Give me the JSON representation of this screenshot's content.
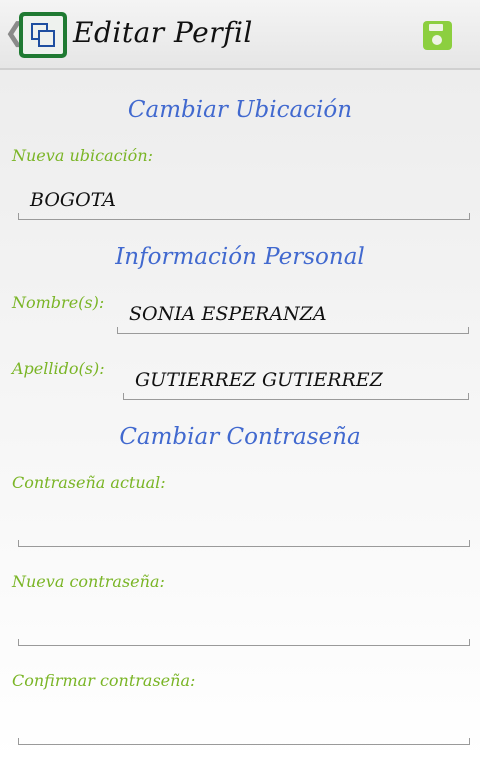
{
  "appbar": {
    "title": "Editar Perfil",
    "back_glyph": "❮",
    "icons": {
      "app": "app-logo-icon",
      "save": "save-icon"
    },
    "accent": "#8ccf3f"
  },
  "sections": {
    "location_title": "Cambiar Ubicación",
    "personal_title": "Información Personal",
    "password_title": "Cambiar Contraseña"
  },
  "fields": {
    "location": {
      "label": "Nueva ubicación:",
      "value": "BOGOTA"
    },
    "first_name": {
      "label": "Nombre(s):",
      "value": "SONIA ESPERANZA"
    },
    "last_name": {
      "label": "Apellido(s):",
      "value": "GUTIERREZ GUTIERREZ"
    },
    "current_password": {
      "label": "Contraseña actual:",
      "value": ""
    },
    "new_password": {
      "label": "Nueva contraseña:",
      "value": ""
    },
    "confirm_password": {
      "label": "Confirmar contraseña:",
      "value": ""
    }
  },
  "colors": {
    "section_title": "#4169cf",
    "label": "#7ab526",
    "brand": "#1f7a32"
  }
}
